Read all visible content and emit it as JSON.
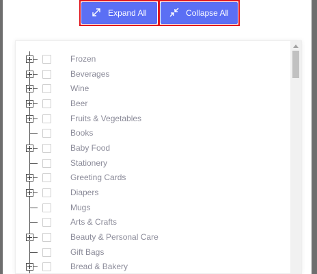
{
  "toolbar": {
    "expand_label": "Expand All",
    "collapse_label": "Collapse All",
    "accent": "#5b6ff4",
    "highlight": "#e0161c"
  },
  "tree": {
    "items": [
      {
        "label": "Frozen",
        "has_children": true
      },
      {
        "label": "Beverages",
        "has_children": true
      },
      {
        "label": "Wine",
        "has_children": true
      },
      {
        "label": "Beer",
        "has_children": true
      },
      {
        "label": "Fruits & Vegetables",
        "has_children": true
      },
      {
        "label": "Books",
        "has_children": false
      },
      {
        "label": "Baby Food",
        "has_children": true
      },
      {
        "label": "Stationery",
        "has_children": false
      },
      {
        "label": "Greeting Cards",
        "has_children": true
      },
      {
        "label": "Diapers",
        "has_children": true
      },
      {
        "label": "Mugs",
        "has_children": false
      },
      {
        "label": "Arts & Crafts",
        "has_children": false
      },
      {
        "label": "Beauty & Personal Care",
        "has_children": true
      },
      {
        "label": "Gift Bags",
        "has_children": false
      },
      {
        "label": "Bread & Bakery",
        "has_children": true
      }
    ]
  }
}
